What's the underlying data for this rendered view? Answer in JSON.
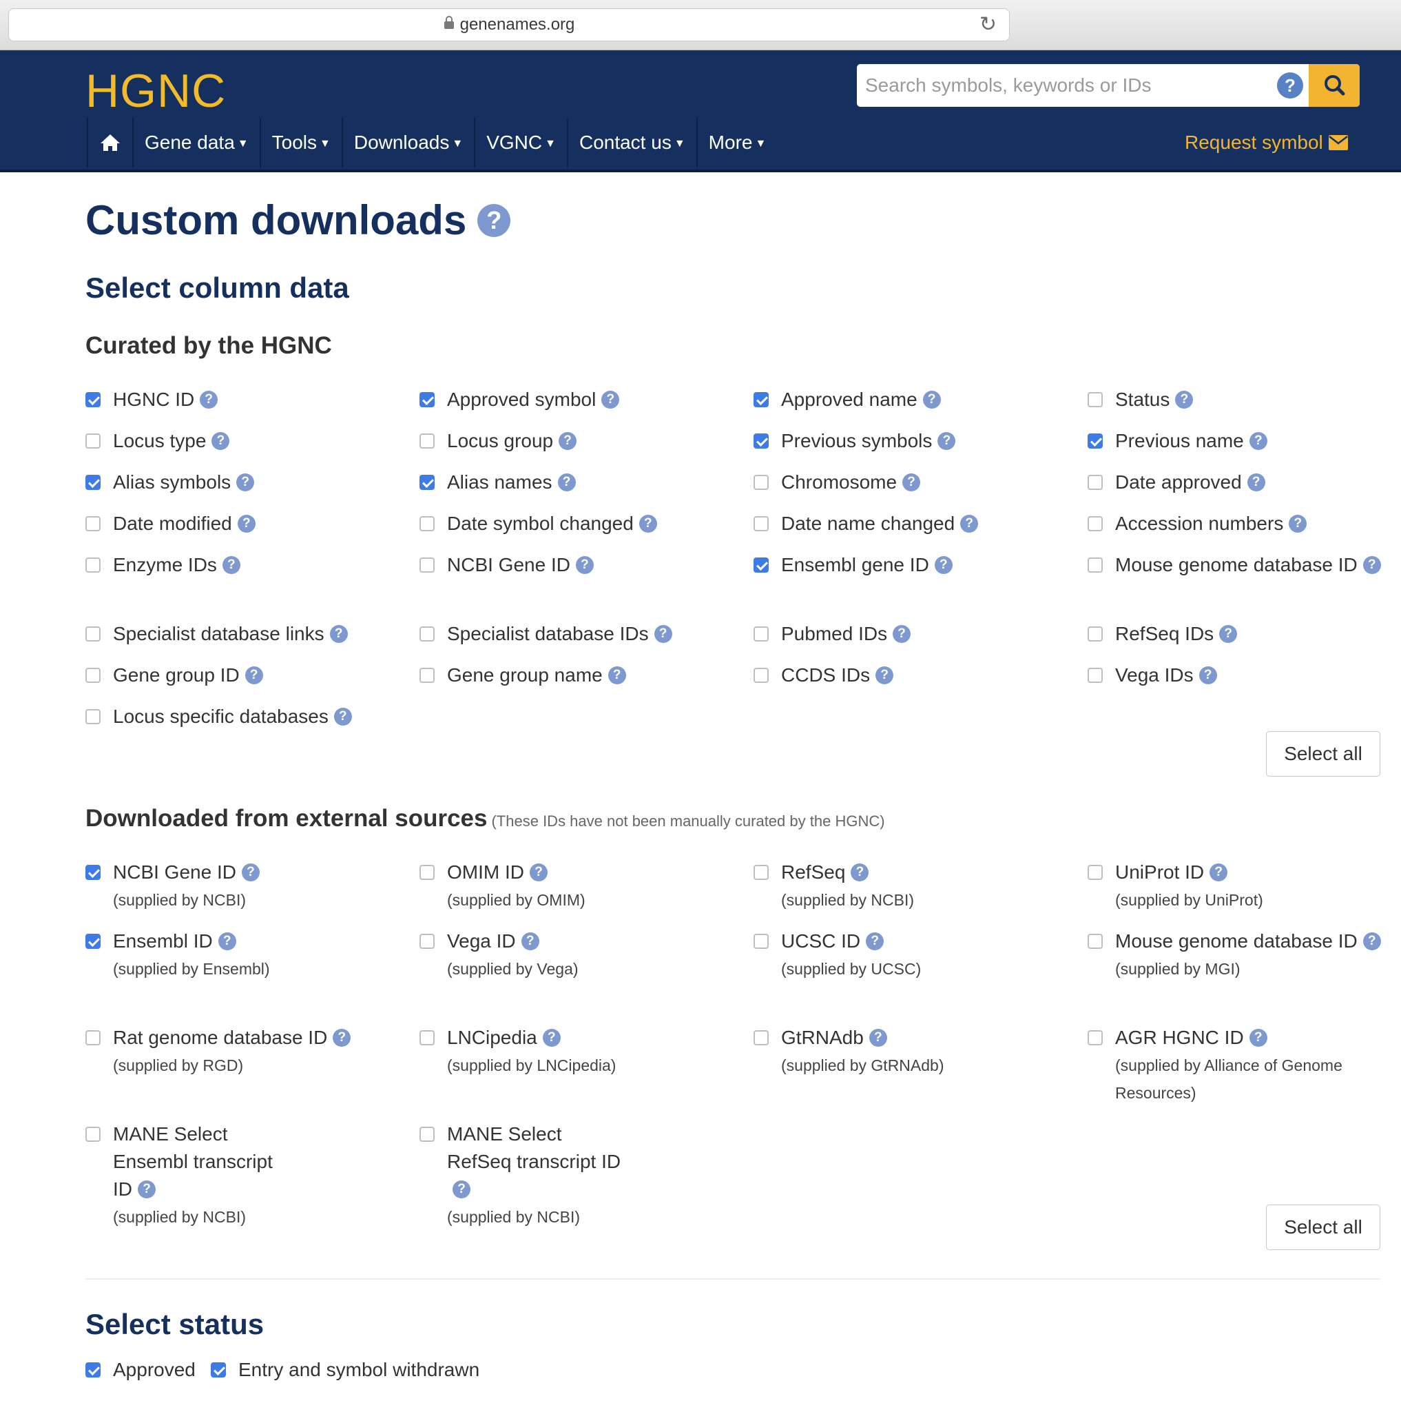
{
  "browser": {
    "url": "genenames.org"
  },
  "header": {
    "logo": "HGNC",
    "search_placeholder": "Search symbols, keywords or IDs",
    "help_mark": "?",
    "nav": [
      {
        "label": "Gene data"
      },
      {
        "label": "Tools"
      },
      {
        "label": "Downloads"
      },
      {
        "label": "VGNC"
      },
      {
        "label": "Contact us"
      },
      {
        "label": "More"
      }
    ],
    "request_symbol": "Request symbol"
  },
  "page": {
    "title": "Custom downloads",
    "help_mark": "?"
  },
  "columns": {
    "heading": "Select column data",
    "curated": {
      "heading": "Curated by the HGNC",
      "select_all": "Select all",
      "items": [
        {
          "label": "HGNC ID",
          "checked": true
        },
        {
          "label": "Approved symbol",
          "checked": true
        },
        {
          "label": "Approved name",
          "checked": true
        },
        {
          "label": "Status",
          "checked": false
        },
        {
          "label": "Locus type",
          "checked": false
        },
        {
          "label": "Locus group",
          "checked": false
        },
        {
          "label": "Previous symbols",
          "checked": true
        },
        {
          "label": "Previous name",
          "checked": true
        },
        {
          "label": "Alias symbols",
          "checked": true
        },
        {
          "label": "Alias names",
          "checked": true
        },
        {
          "label": "Chromosome",
          "checked": false
        },
        {
          "label": "Date approved",
          "checked": false
        },
        {
          "label": "Date modified",
          "checked": false
        },
        {
          "label": "Date symbol changed",
          "checked": false
        },
        {
          "label": "Date name changed",
          "checked": false
        },
        {
          "label": "Accession numbers",
          "checked": false
        },
        {
          "label": "Enzyme IDs",
          "checked": false
        },
        {
          "label": "NCBI Gene ID",
          "checked": false
        },
        {
          "label": "Ensembl gene ID",
          "checked": true
        },
        {
          "label": "Mouse genome database ID",
          "checked": false
        },
        {
          "label": "Specialist database links",
          "checked": false
        },
        {
          "label": "Specialist database IDs",
          "checked": false
        },
        {
          "label": "Pubmed IDs",
          "checked": false
        },
        {
          "label": "RefSeq IDs",
          "checked": false
        },
        {
          "label": "Gene group ID",
          "checked": false
        },
        {
          "label": "Gene group name",
          "checked": false
        },
        {
          "label": "CCDS IDs",
          "checked": false
        },
        {
          "label": "Vega IDs",
          "checked": false
        },
        {
          "label": "Locus specific databases",
          "checked": false
        }
      ]
    },
    "external": {
      "heading": "Downloaded from external sources",
      "note": "(These IDs have not been manually curated by the HGNC)",
      "select_all": "Select all",
      "items": [
        {
          "label": "NCBI Gene ID",
          "supplier": "(supplied by NCBI)",
          "checked": true
        },
        {
          "label": "OMIM ID",
          "supplier": "(supplied by OMIM)",
          "checked": false
        },
        {
          "label": "RefSeq",
          "supplier": "(supplied by NCBI)",
          "checked": false
        },
        {
          "label": "UniProt ID",
          "supplier": "(supplied by UniProt)",
          "checked": false
        },
        {
          "label": "Ensembl ID",
          "supplier": "(supplied by Ensembl)",
          "checked": true
        },
        {
          "label": "Vega ID",
          "supplier": "(supplied by Vega)",
          "checked": false
        },
        {
          "label": "UCSC ID",
          "supplier": "(supplied by UCSC)",
          "checked": false
        },
        {
          "label": "Mouse genome database ID",
          "supplier": "(supplied by MGI)",
          "checked": false
        },
        {
          "label": "Rat genome database ID",
          "supplier": "(supplied by RGD)",
          "checked": false
        },
        {
          "label": "LNCipedia",
          "supplier": "(supplied by LNCipedia)",
          "checked": false
        },
        {
          "label": "GtRNAdb",
          "supplier": "(supplied by GtRNAdb)",
          "checked": false
        },
        {
          "label": "AGR HGNC ID",
          "supplier": "(supplied by Alliance of Genome Resources)",
          "checked": false
        },
        {
          "label": "MANE Select Ensembl transcript ID",
          "supplier": "(supplied by NCBI)",
          "checked": false
        },
        {
          "label": "MANE Select RefSeq transcript ID",
          "supplier": "(supplied by NCBI)",
          "checked": false
        }
      ]
    }
  },
  "status": {
    "heading": "Select status",
    "items": [
      {
        "label": "Approved",
        "checked": true
      },
      {
        "label": "Entry and symbol withdrawn",
        "checked": true
      }
    ]
  },
  "colors": {
    "header_bg": "#15305e",
    "accent_gold": "#f3b431",
    "checkbox_blue": "#3f7be6",
    "help_icon": "#7d99cf"
  }
}
